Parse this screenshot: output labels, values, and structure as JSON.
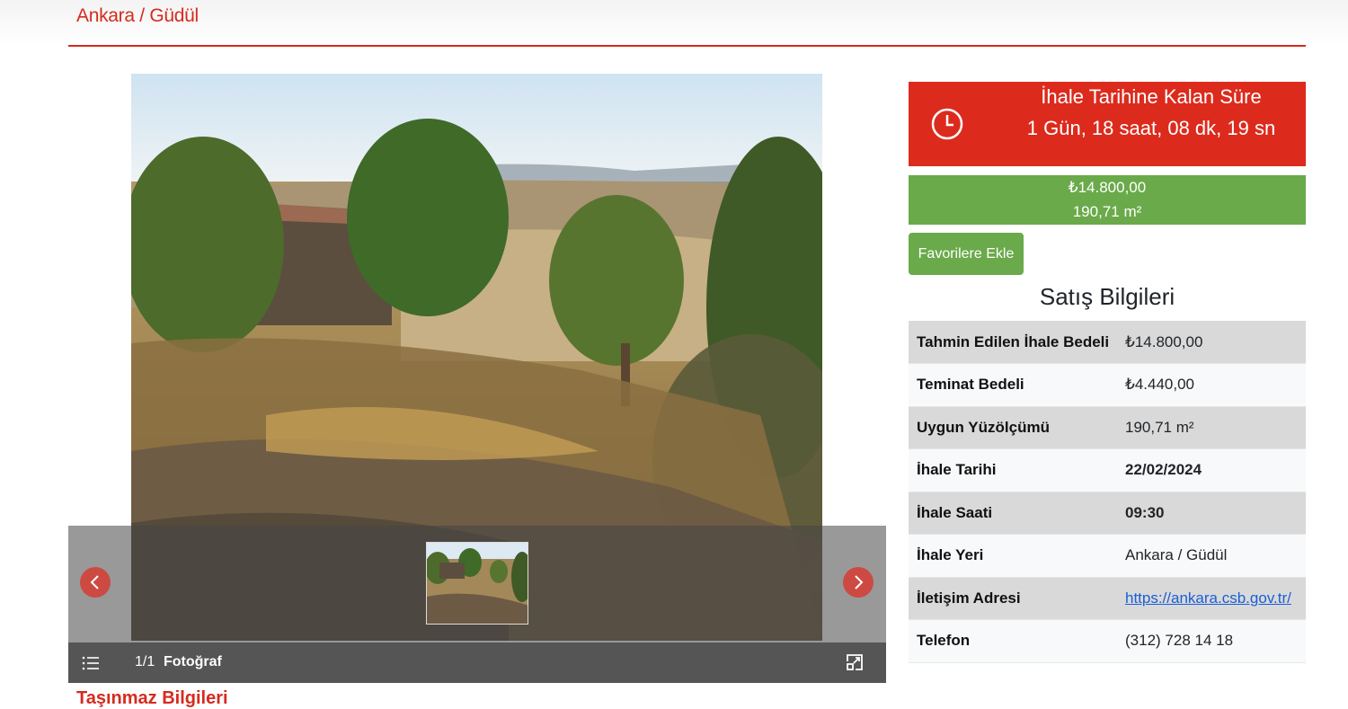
{
  "header": {
    "location_title": "Ankara / Güdül"
  },
  "gallery": {
    "counter": "1/1",
    "label": "Fotoğraf",
    "icons": {
      "prev": "chevron-left-icon",
      "next": "chevron-right-icon",
      "list": "list-icon",
      "expand": "expand-icon"
    }
  },
  "countdown": {
    "title": "İhale Tarihine Kalan Süre",
    "value": "1 Gün, 18 saat, 08 dk, 19 sn",
    "icon": "clock-icon"
  },
  "price_box": {
    "price": "₺14.800,00",
    "area": "190,71 m²"
  },
  "favorite_button_label": "Favorilere Ekle",
  "sales_info": {
    "heading": "Satış Bilgileri",
    "rows": [
      {
        "label": "Tahmin Edilen İhale Bedeli",
        "value": "₺14.800,00"
      },
      {
        "label": "Teminat Bedeli",
        "value": "₺4.440,00"
      },
      {
        "label": "Uygun Yüzölçümü",
        "value": "190,71 m²"
      },
      {
        "label": "İhale Tarihi",
        "value": "22/02/2024"
      },
      {
        "label": "İhale Saati",
        "value": "09:30"
      },
      {
        "label": "İhale Yeri",
        "value": "Ankara / Güdül"
      },
      {
        "label": "İletişim Adresi",
        "value": "https://ankara.csb.gov.tr/"
      },
      {
        "label": "Telefon",
        "value": "(312) 728 14 18"
      }
    ]
  },
  "next_section_title": "Taşınmaz Bilgileri",
  "colors": {
    "accent_red": "#dc2b1d",
    "accent_green": "#6aaa4a",
    "link_blue": "#1a5fd6"
  }
}
